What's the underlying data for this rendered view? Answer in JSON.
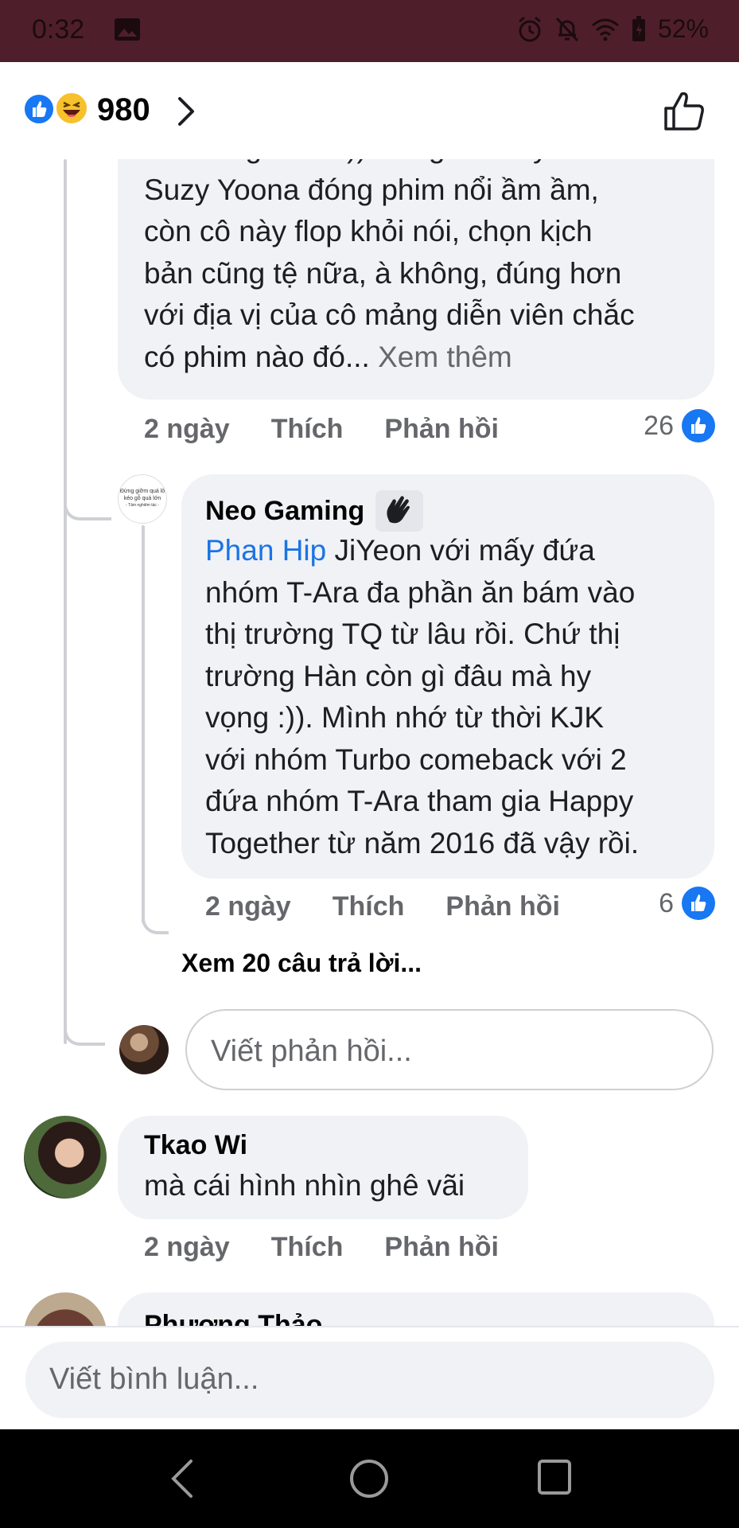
{
  "status_bar": {
    "time": "0:32",
    "battery": "52%"
  },
  "header": {
    "reaction_count": "980"
  },
  "comments": {
    "first": {
      "partial_top": "còn cái gì nữa :)) Cũng thời Jiyeon có",
      "lines": [
        "Suzy Yoona đóng phim nổi ầm ầm,",
        "còn cô này flop khỏi nói, chọn kịch",
        "bản cũng tệ nữa, à không, đúng hơn",
        "với địa vị của cô mảng diễn viên chắc"
      ],
      "last_line": "có phim nào đó...",
      "see_more": "Xem thêm",
      "time": "2 ngày",
      "like_label": "Thích",
      "reply_label": "Phản hồi",
      "like_count": "26"
    },
    "reply": {
      "author": "Neo Gaming",
      "avatar_text_1": "Đừng giỡm quá lố",
      "avatar_text_2": "kéo gỗ quá lớn",
      "avatar_text_3": "- Tâm nghiêm tác -",
      "mention": "Phan Hip",
      "first_line_rest": " JiYeon với mấy đứa",
      "lines": [
        "nhóm T-Ara đa phần ăn bám vào",
        "thị trường TQ từ lâu rồi. Chứ thị",
        "trường Hàn còn gì đâu mà hy",
        "vọng :)). Mình nhớ từ thời KJK",
        "với nhóm Turbo comeback với 2",
        "đứa nhóm T-Ara tham gia Happy",
        "Together từ năm 2016 đã vậy rồi."
      ],
      "time": "2 ngày",
      "like_label": "Thích",
      "reply_label": "Phản hồi",
      "like_count": "6"
    },
    "view_replies": "Xem 20 câu trả lời...",
    "reply_input_placeholder": "Viết phản hồi...",
    "second": {
      "author": "Tkao Wi",
      "text": "mà cái hình nhìn ghê vãi",
      "time": "2 ngày",
      "like_label": "Thích",
      "reply_label": "Phản hồi"
    },
    "third": {
      "author": "Phương Thảo"
    }
  },
  "comment_input_placeholder": "Viết bình luận...",
  "colors": {
    "accent": "#1877f2",
    "status_bar": "#4e1f2a",
    "bubble": "#f0f2f5"
  }
}
